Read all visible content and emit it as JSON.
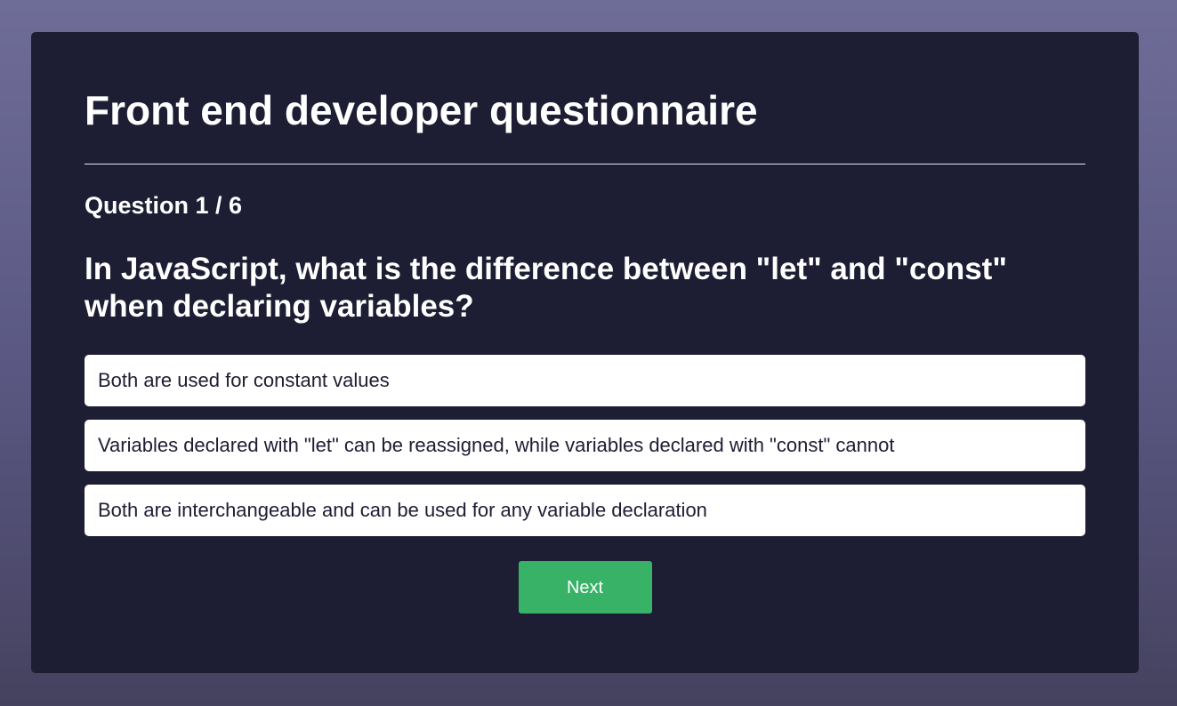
{
  "quiz": {
    "title": "Front end developer questionnaire",
    "counter": "Question 1 / 6",
    "question": "In JavaScript, what is the difference between \"let\" and \"const\" when declaring variables?",
    "options": [
      {
        "label": "Both are used for constant values"
      },
      {
        "label": "Variables declared with \"let\" can be reassigned, while variables declared with \"const\" cannot"
      },
      {
        "label": "Both are interchangeable and can be used for any variable declaration"
      }
    ],
    "next_label": "Next"
  },
  "colors": {
    "background_top": "#6f6d98",
    "card": "#1d1d33",
    "option_bg": "#ffffff",
    "accent_button": "#37b266"
  }
}
